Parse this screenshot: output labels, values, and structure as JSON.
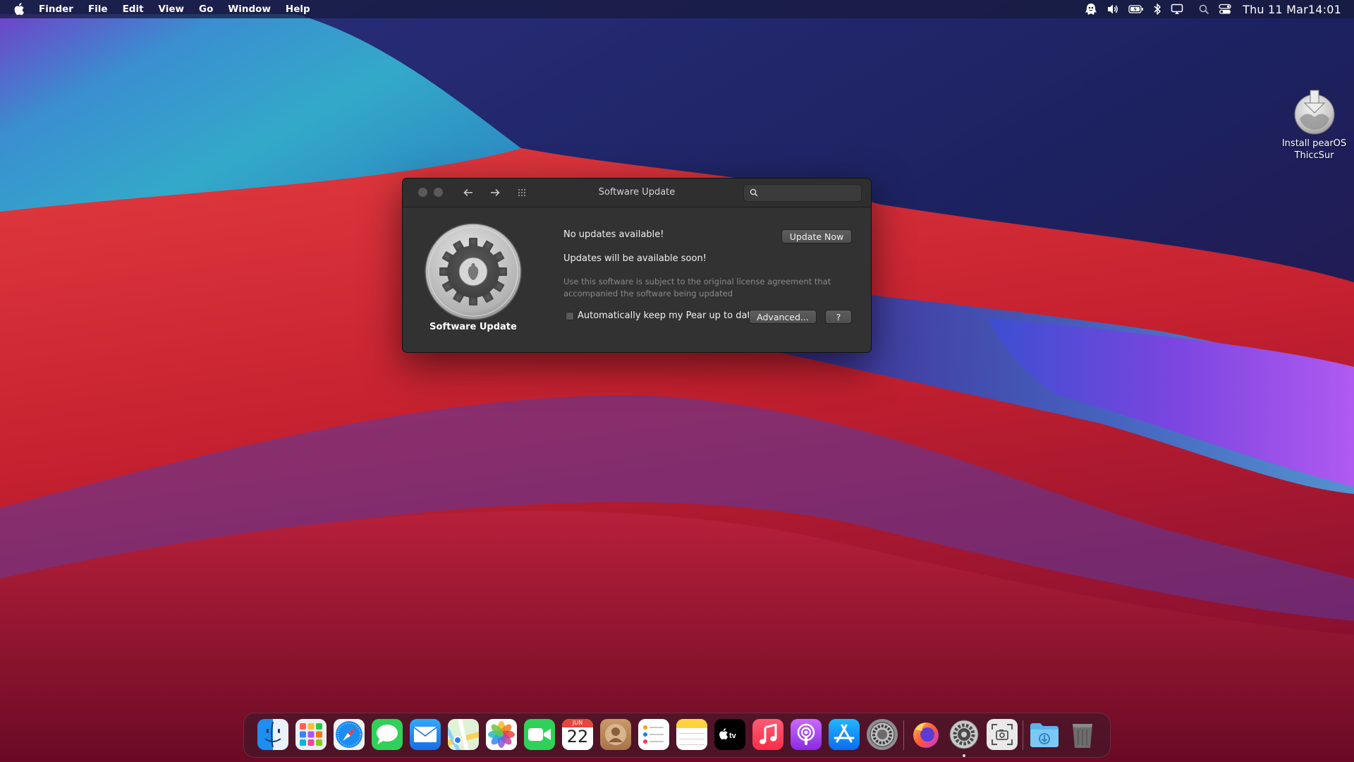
{
  "menubar": {
    "app_name": "Finder",
    "menus": [
      "File",
      "Edit",
      "View",
      "Go",
      "Window",
      "Help"
    ],
    "clock": "Thu 11 Mar14:01",
    "status_icons": [
      "pear-mascot-icon",
      "volume-icon",
      "battery-icon",
      "bluetooth-icon",
      "display-mirror-icon",
      "spotlight-icon",
      "control-center-icon"
    ]
  },
  "desktop": {
    "icons": [
      {
        "label": "Install pearOS\nThiccSur",
        "icon": "install-disk-icon"
      }
    ]
  },
  "window": {
    "title": "Software Update",
    "search_placeholder": "",
    "pane_label": "Software Update",
    "status_title": "No updates available!",
    "status_subtitle": "Updates will be available soon!",
    "license_text": "Use this software is subject to the original license agreement that accompanied the software being updated",
    "auto_update_label": "Automatically keep my Pear up to date",
    "auto_update_checked": false,
    "buttons": {
      "update_now": "Update Now",
      "advanced": "Advanced...",
      "help": "?"
    }
  },
  "dock": {
    "calendar": {
      "month": "JUN",
      "day": "22"
    },
    "items": [
      "Finder",
      "Launchpad",
      "Safari",
      "Messages",
      "Mail",
      "Maps",
      "Photos",
      "FaceTime",
      "Calendar",
      "Contacts",
      "Reminders",
      "Notes",
      "TV",
      "Music",
      "Podcasts",
      "App Store",
      "System Preferences",
      "Firefox",
      "Software Update",
      "Screenshot",
      "Downloads",
      "Trash"
    ]
  },
  "colors": {
    "menubar_bg": "#161a3a",
    "window_bg": "#323232",
    "window_titlebar": "#2f2f2f",
    "button_bg": "#575757"
  }
}
